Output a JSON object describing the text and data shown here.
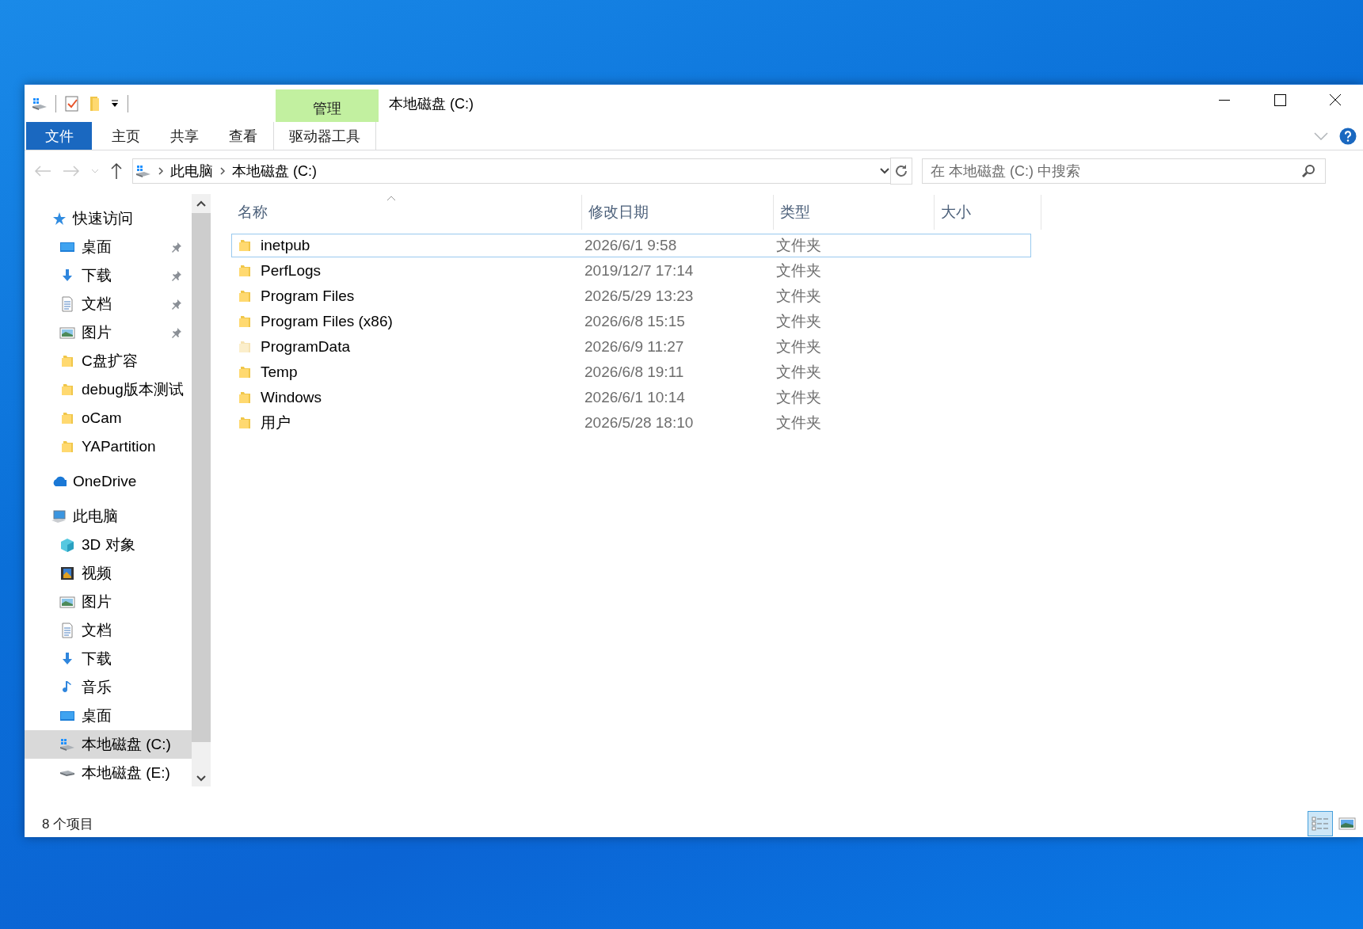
{
  "window": {
    "title": "本地磁盘 (C:)"
  },
  "ribbon": {
    "context_group": "管理",
    "tabs": [
      {
        "label": "文件",
        "kind": "file",
        "selected": false
      },
      {
        "label": "主页",
        "kind": "normal",
        "selected": false
      },
      {
        "label": "共享",
        "kind": "normal",
        "selected": false
      },
      {
        "label": "查看",
        "kind": "normal",
        "selected": false
      },
      {
        "label": "驱动器工具",
        "kind": "contextual",
        "selected": false
      }
    ]
  },
  "address": {
    "breadcrumbs": [
      "此电脑",
      "本地磁盘 (C:)"
    ],
    "search_placeholder": "在 本地磁盘 (C:) 中搜索"
  },
  "nav": [
    {
      "label": "快速访问",
      "kind": "star",
      "selected": false,
      "children": [
        {
          "label": "桌面",
          "kind": "desktop",
          "pinned": true,
          "selected": false
        },
        {
          "label": "下载",
          "kind": "download",
          "pinned": true,
          "selected": false
        },
        {
          "label": "文档",
          "kind": "document",
          "pinned": true,
          "selected": false
        },
        {
          "label": "图片",
          "kind": "picture",
          "pinned": true,
          "selected": false
        },
        {
          "label": "C盘扩容",
          "kind": "folder",
          "pinned": false,
          "selected": false
        },
        {
          "label": "debug版本测试",
          "kind": "folder",
          "pinned": false,
          "selected": false
        },
        {
          "label": "oCam",
          "kind": "folder",
          "pinned": false,
          "selected": false
        },
        {
          "label": "YAPartition",
          "kind": "folder",
          "pinned": false,
          "selected": false
        }
      ]
    },
    {
      "label": "OneDrive",
      "kind": "cloud",
      "selected": false
    },
    {
      "label": "此电脑",
      "kind": "pc",
      "selected": false,
      "children": [
        {
          "label": "3D 对象",
          "kind": "cube",
          "selected": false
        },
        {
          "label": "视频",
          "kind": "video",
          "selected": false
        },
        {
          "label": "图片",
          "kind": "picture",
          "selected": false
        },
        {
          "label": "文档",
          "kind": "document",
          "selected": false
        },
        {
          "label": "下载",
          "kind": "download",
          "selected": false
        },
        {
          "label": "音乐",
          "kind": "music",
          "selected": false
        },
        {
          "label": "桌面",
          "kind": "desktop",
          "selected": false
        },
        {
          "label": "本地磁盘 (C:)",
          "kind": "drive-win",
          "selected": true
        },
        {
          "label": "本地磁盘 (E:)",
          "kind": "drive",
          "selected": false
        }
      ]
    }
  ],
  "files": {
    "columns": [
      {
        "label": "名称",
        "sorted": true
      },
      {
        "label": "修改日期",
        "sorted": false
      },
      {
        "label": "类型",
        "sorted": false
      },
      {
        "label": "大小",
        "sorted": false
      }
    ],
    "rows": [
      {
        "name": "inetpub",
        "date": "2026/6/1 9:58",
        "type": "文件夹",
        "focused": true,
        "hidden": false
      },
      {
        "name": "PerfLogs",
        "date": "2019/12/7 17:14",
        "type": "文件夹",
        "focused": false,
        "hidden": false
      },
      {
        "name": "Program Files",
        "date": "2026/5/29 13:23",
        "type": "文件夹",
        "focused": false,
        "hidden": false
      },
      {
        "name": "Program Files (x86)",
        "date": "2026/6/8 15:15",
        "type": "文件夹",
        "focused": false,
        "hidden": false
      },
      {
        "name": "ProgramData",
        "date": "2026/6/9 11:27",
        "type": "文件夹",
        "focused": false,
        "hidden": true
      },
      {
        "name": "Temp",
        "date": "2026/6/8 19:11",
        "type": "文件夹",
        "focused": false,
        "hidden": false
      },
      {
        "name": "Windows",
        "date": "2026/6/1 10:14",
        "type": "文件夹",
        "focused": false,
        "hidden": false
      },
      {
        "name": "用户",
        "date": "2026/5/28 18:10",
        "type": "文件夹",
        "focused": false,
        "hidden": false
      }
    ]
  },
  "status": {
    "count": "8 个项目",
    "views": [
      {
        "kind": "details",
        "selected": true
      },
      {
        "kind": "thumbnails",
        "selected": false
      }
    ]
  }
}
